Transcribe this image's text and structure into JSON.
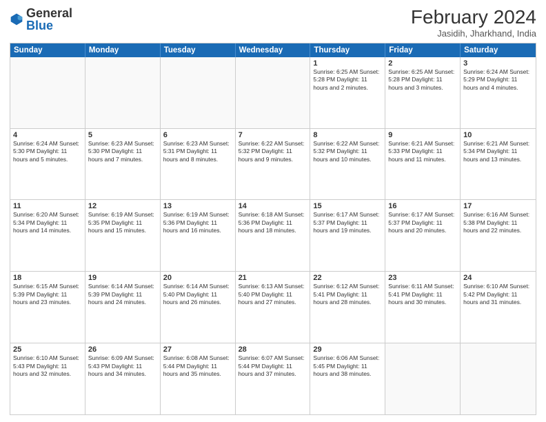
{
  "logo": {
    "general": "General",
    "blue": "Blue"
  },
  "header": {
    "month_year": "February 2024",
    "location": "Jasidih, Jharkhand, India"
  },
  "days_of_week": [
    "Sunday",
    "Monday",
    "Tuesday",
    "Wednesday",
    "Thursday",
    "Friday",
    "Saturday"
  ],
  "weeks": [
    [
      {
        "day": "",
        "text": ""
      },
      {
        "day": "",
        "text": ""
      },
      {
        "day": "",
        "text": ""
      },
      {
        "day": "",
        "text": ""
      },
      {
        "day": "1",
        "text": "Sunrise: 6:25 AM\nSunset: 5:28 PM\nDaylight: 11 hours and 2 minutes."
      },
      {
        "day": "2",
        "text": "Sunrise: 6:25 AM\nSunset: 5:28 PM\nDaylight: 11 hours and 3 minutes."
      },
      {
        "day": "3",
        "text": "Sunrise: 6:24 AM\nSunset: 5:29 PM\nDaylight: 11 hours and 4 minutes."
      }
    ],
    [
      {
        "day": "4",
        "text": "Sunrise: 6:24 AM\nSunset: 5:30 PM\nDaylight: 11 hours and 5 minutes."
      },
      {
        "day": "5",
        "text": "Sunrise: 6:23 AM\nSunset: 5:30 PM\nDaylight: 11 hours and 7 minutes."
      },
      {
        "day": "6",
        "text": "Sunrise: 6:23 AM\nSunset: 5:31 PM\nDaylight: 11 hours and 8 minutes."
      },
      {
        "day": "7",
        "text": "Sunrise: 6:22 AM\nSunset: 5:32 PM\nDaylight: 11 hours and 9 minutes."
      },
      {
        "day": "8",
        "text": "Sunrise: 6:22 AM\nSunset: 5:32 PM\nDaylight: 11 hours and 10 minutes."
      },
      {
        "day": "9",
        "text": "Sunrise: 6:21 AM\nSunset: 5:33 PM\nDaylight: 11 hours and 11 minutes."
      },
      {
        "day": "10",
        "text": "Sunrise: 6:21 AM\nSunset: 5:34 PM\nDaylight: 11 hours and 13 minutes."
      }
    ],
    [
      {
        "day": "11",
        "text": "Sunrise: 6:20 AM\nSunset: 5:34 PM\nDaylight: 11 hours and 14 minutes."
      },
      {
        "day": "12",
        "text": "Sunrise: 6:19 AM\nSunset: 5:35 PM\nDaylight: 11 hours and 15 minutes."
      },
      {
        "day": "13",
        "text": "Sunrise: 6:19 AM\nSunset: 5:36 PM\nDaylight: 11 hours and 16 minutes."
      },
      {
        "day": "14",
        "text": "Sunrise: 6:18 AM\nSunset: 5:36 PM\nDaylight: 11 hours and 18 minutes."
      },
      {
        "day": "15",
        "text": "Sunrise: 6:17 AM\nSunset: 5:37 PM\nDaylight: 11 hours and 19 minutes."
      },
      {
        "day": "16",
        "text": "Sunrise: 6:17 AM\nSunset: 5:37 PM\nDaylight: 11 hours and 20 minutes."
      },
      {
        "day": "17",
        "text": "Sunrise: 6:16 AM\nSunset: 5:38 PM\nDaylight: 11 hours and 22 minutes."
      }
    ],
    [
      {
        "day": "18",
        "text": "Sunrise: 6:15 AM\nSunset: 5:39 PM\nDaylight: 11 hours and 23 minutes."
      },
      {
        "day": "19",
        "text": "Sunrise: 6:14 AM\nSunset: 5:39 PM\nDaylight: 11 hours and 24 minutes."
      },
      {
        "day": "20",
        "text": "Sunrise: 6:14 AM\nSunset: 5:40 PM\nDaylight: 11 hours and 26 minutes."
      },
      {
        "day": "21",
        "text": "Sunrise: 6:13 AM\nSunset: 5:40 PM\nDaylight: 11 hours and 27 minutes."
      },
      {
        "day": "22",
        "text": "Sunrise: 6:12 AM\nSunset: 5:41 PM\nDaylight: 11 hours and 28 minutes."
      },
      {
        "day": "23",
        "text": "Sunrise: 6:11 AM\nSunset: 5:41 PM\nDaylight: 11 hours and 30 minutes."
      },
      {
        "day": "24",
        "text": "Sunrise: 6:10 AM\nSunset: 5:42 PM\nDaylight: 11 hours and 31 minutes."
      }
    ],
    [
      {
        "day": "25",
        "text": "Sunrise: 6:10 AM\nSunset: 5:43 PM\nDaylight: 11 hours and 32 minutes."
      },
      {
        "day": "26",
        "text": "Sunrise: 6:09 AM\nSunset: 5:43 PM\nDaylight: 11 hours and 34 minutes."
      },
      {
        "day": "27",
        "text": "Sunrise: 6:08 AM\nSunset: 5:44 PM\nDaylight: 11 hours and 35 minutes."
      },
      {
        "day": "28",
        "text": "Sunrise: 6:07 AM\nSunset: 5:44 PM\nDaylight: 11 hours and 37 minutes."
      },
      {
        "day": "29",
        "text": "Sunrise: 6:06 AM\nSunset: 5:45 PM\nDaylight: 11 hours and 38 minutes."
      },
      {
        "day": "",
        "text": ""
      },
      {
        "day": "",
        "text": ""
      }
    ]
  ]
}
